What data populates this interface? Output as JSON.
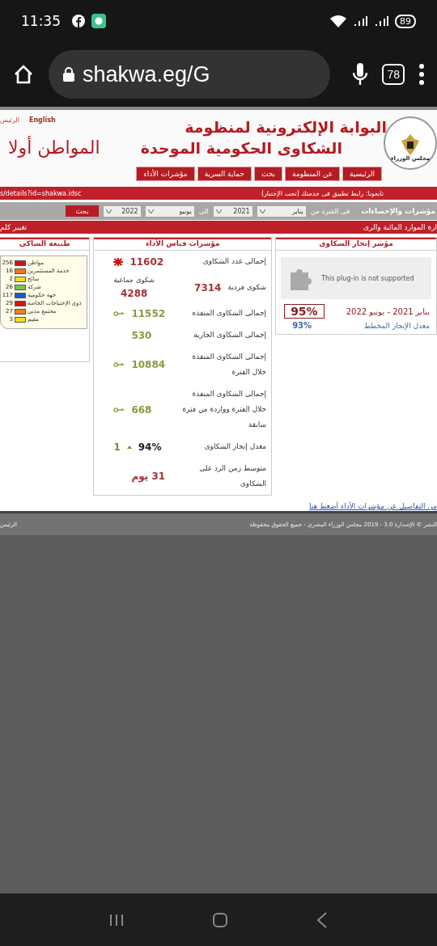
{
  "status_bar": {
    "time": "11:35",
    "battery": "89"
  },
  "browser": {
    "url": "shakwa.eg/G",
    "tab_count": "78"
  },
  "header": {
    "home_link": "الرئيس",
    "language_link": "English",
    "title_lines": [
      "البوابة الإلكترونية لمنظومة",
      "الشكاوى الحكومية الموحدة"
    ],
    "slogan": "المواطن أولا",
    "logo_text": "مجلس الوزراء"
  },
  "nav_tabs": [
    {
      "label": "الرئيسية"
    },
    {
      "label": "عن المنظومة"
    },
    {
      "label": "بحث"
    },
    {
      "label": "حماية السرية"
    },
    {
      "label": "مؤشرات الأداء"
    }
  ],
  "ticker": {
    "text": "تابعونا: رابط تطبيق فى خدمتك (تحت الإختبار)",
    "link": "s/details?id=shakwa.idsc"
  },
  "filter": {
    "title": "مؤشرات والإحصاءات",
    "from_label": "فى الفترة من",
    "from_month": "يناير",
    "from_year": "2021",
    "to_label": "الى",
    "to_month": "يونيو",
    "to_year": "2022",
    "search_button": "بحث"
  },
  "agency_bar": {
    "name": "ارة الموارد المائية والرى",
    "change_link": "تغيير كلم"
  },
  "achievement": {
    "title": "مؤشر إنجاز الشكاوى",
    "plugin_message": "This plug-in is not supported",
    "period": "يناير 2021 - يونيو 2022",
    "rate": "95%",
    "planned_label": "معدل الإنجاز المخطط",
    "planned_rate": "93%"
  },
  "kpis": {
    "title": "مؤشرات قياس الأداء",
    "rows": [
      {
        "kind": "star",
        "label": "إجمالى عدد الشكاوى",
        "value": "11602"
      },
      {
        "kind": "split",
        "label": "شكوى فردية",
        "value": "7314",
        "group_label": "شكوى جماعية",
        "group_value": "4288"
      },
      {
        "kind": "key",
        "label": "إجمالى الشكاوى المنفذه",
        "value": "11552"
      },
      {
        "kind": "plain",
        "label": "إجمالى الشكاوى الجارية",
        "value": "530"
      },
      {
        "kind": "key",
        "label": "إجمالى الشكاوى المنفذة خلال الفترة",
        "value": "10884"
      },
      {
        "kind": "key",
        "label": "إجمالى الشكاوى المنفذة خلال الفترة وواردة من فترة سابقة",
        "value": "668"
      },
      {
        "kind": "rate",
        "label": "معدل إنجاز الشكاوى",
        "value": "94%",
        "change": "1"
      },
      {
        "kind": "days",
        "label": "متوسط زمن الرد على الشكاوى",
        "value": "31 يوم"
      }
    ]
  },
  "complainant_types": {
    "title": "طبيعة الشاكى",
    "items": [
      {
        "label": "مواطن",
        "count": "256",
        "color": "#c8141c"
      },
      {
        "label": "خدمة المستثمرين",
        "count": "16",
        "color": "#f07820"
      },
      {
        "label": "سائح",
        "count": "2",
        "color": "#f0e020"
      },
      {
        "label": "شركة",
        "count": "26",
        "color": "#78c850"
      },
      {
        "label": "جهة حكومية",
        "count": "117",
        "color": "#1860c0"
      },
      {
        "label": "ذوى الإحتياجات الخاصة",
        "count": "29",
        "color": "#d01818"
      },
      {
        "label": "مجتمع مدنى",
        "count": "27",
        "color": "#f08020"
      },
      {
        "label": "مقيم",
        "count": "3",
        "color": "#f0e020"
      }
    ]
  },
  "details_link": "من التفاصيل عن مؤشرات الأداء أضغط هنا",
  "footer": {
    "copyright": "النشر © الإصدارة 3.0 - 2019 مجلس الوزراء المصرى - جميع الحقوق محفوظة",
    "home_link": "الرئيس"
  }
}
